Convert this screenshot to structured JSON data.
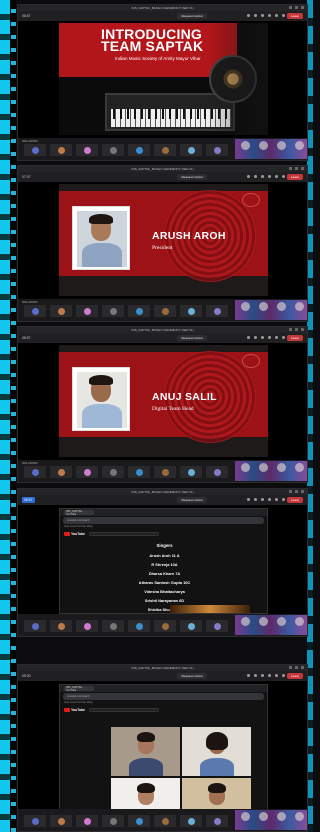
{
  "meeting": {
    "title": "IMS_SAPTAK_BANGO CEREMONY (SEP 21)",
    "request_control": "Request control",
    "leave": "Leave"
  },
  "panels": [
    {
      "time": "08:57",
      "presenter": "IMS ADMIN"
    },
    {
      "time": "07:07",
      "presenter": "IMS ADMIN"
    },
    {
      "time": "08:57",
      "presenter": "IMS ADMIN"
    },
    {
      "time": "08:57",
      "presenter": ""
    },
    {
      "time": "09:30",
      "presenter": ""
    }
  ],
  "slide1": {
    "heading_line1": "INTRODUCING",
    "heading_line2": "TEAM SAPTAK",
    "subtitle": "Indian Music Society of Amity Mayur Vihar"
  },
  "slide2": {
    "name": "ARUSH AROH",
    "role": "President"
  },
  "slide3": {
    "name": "ANUJ SALIL",
    "role": "Digital Team Head"
  },
  "browser": {
    "tab_label": "IMS_SAPTAK - YouTube",
    "address": "youtube.com/watch",
    "bookmarks": "Apps   Gmail   YouTube   Maps",
    "yt_label": "YouTube"
  },
  "credits": {
    "heading": "Singers",
    "names": [
      "Arush Aroh 11 A",
      "R Shreeja 10A",
      "Dharsa Khare 7A",
      "Atharav Santosh Gupta 10C",
      "Videsha Bhattacharya",
      "Srishti Narayanan 6D",
      "Shivika Shukla 5A",
      "Avni Gupta 10B"
    ]
  },
  "colors": {
    "accent_red": "#b3161a",
    "leave_red": "#c5373a",
    "border_cyan": "#13c6ee"
  },
  "icons": [
    "close-icon",
    "minimize-icon",
    "maximize-icon",
    "chat-icon",
    "people-icon",
    "camera-icon",
    "mic-icon",
    "share-icon",
    "more-icon"
  ]
}
